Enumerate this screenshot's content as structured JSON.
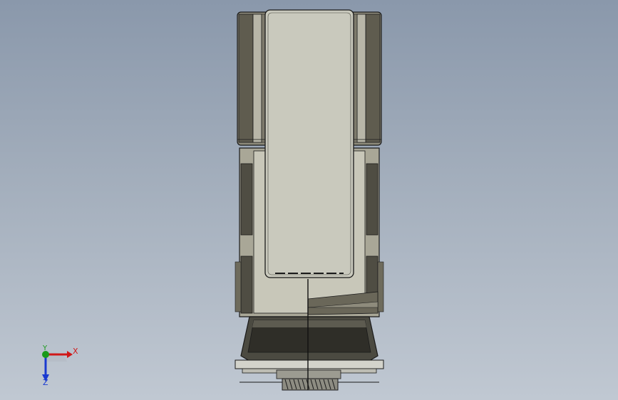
{
  "viewport": {
    "background_top": "#8a98ab",
    "background_bottom": "#c0c8d2",
    "view": "front"
  },
  "triad": {
    "x_label": "X",
    "y_label": "Y",
    "z_label": "Z",
    "x_color": "#d01818",
    "y_color": "#1a9a1a",
    "z_color": "#1a3ad0"
  },
  "model": {
    "body_color": "#c6c6ba",
    "shade_color": "#6e6b5c",
    "dark_color": "#3f3d35",
    "edge_color": "#1a1a1a"
  }
}
